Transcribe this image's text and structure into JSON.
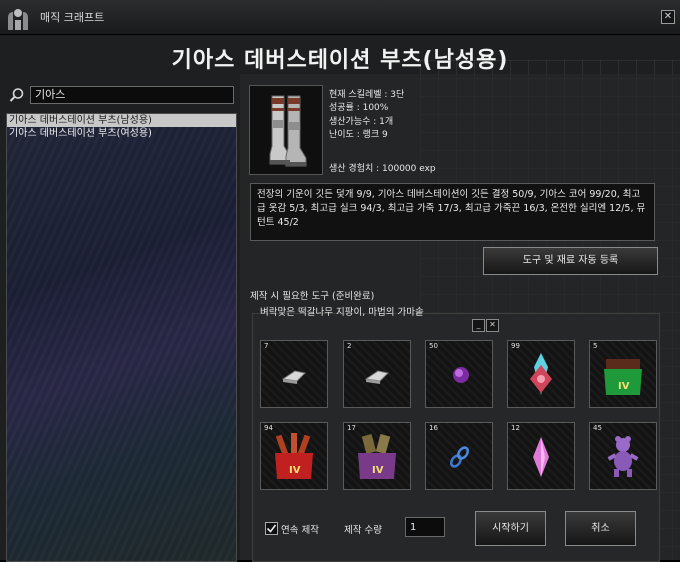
{
  "window": {
    "title": "매직 크래프트",
    "close_glyph": "✕"
  },
  "heading": "기아스 데버스테이션 부츠(남성용)",
  "search": {
    "value": "기아스"
  },
  "recipe_list": [
    {
      "label": "기아스 데버스테이션 부츠(남성용)",
      "selected": true
    },
    {
      "label": "기아스 데버스테이션 부츠(여성용)",
      "selected": false
    }
  ],
  "item_info": {
    "skill_level": "현재 스킬레벨 : 3단",
    "success_rate": "성공률 : 100%",
    "craftable_count": "생산가능수 : 1개",
    "difficulty": "난이도 : 랭크 9",
    "exp": "생산 경험치 : 100000 exp",
    "image_icon": "boots-icon"
  },
  "materials_text": "전장의 기운이 깃든 덫개 9/9, 기아스 데버스테이션이 깃든 결정 50/9, 기아스 코어 99/20, 최고급 옷감 5/3, 최고급 실크 94/3, 최고급 가죽 17/3, 최고급 가죽끈 16/3, 온전한 실리엔 12/5, 뮤턴트 45/2",
  "auto_register_button": "도구 및 재료 자동 등록",
  "tools": {
    "label": "제작 시 필요한 도구 (준비완료)",
    "list": "벼락맞은 떡갈나무 지팡이, 마법의 가마솥"
  },
  "panel_buttons": {
    "minimize": "_",
    "close": "✕"
  },
  "material_slots": [
    {
      "qty": "7",
      "icon": "metal-ingot-icon"
    },
    {
      "qty": "2",
      "icon": "metal-ingot-icon"
    },
    {
      "qty": "50",
      "icon": "purple-gem-icon"
    },
    {
      "qty": "99",
      "icon": "crystal-core-icon"
    },
    {
      "qty": "5",
      "icon": "green-bag-iv-icon"
    },
    {
      "qty": "94",
      "icon": "red-bag-iv-icon"
    },
    {
      "qty": "17",
      "icon": "brown-bag-iv-icon"
    },
    {
      "qty": "16",
      "icon": "chain-link-icon"
    },
    {
      "qty": "12",
      "icon": "pink-crystal-icon"
    },
    {
      "qty": "45",
      "icon": "purple-creature-icon"
    }
  ],
  "footer": {
    "continuous_label": "연속 제작",
    "continuous_checked": true,
    "quantity_label": "제작 수량",
    "quantity_value": "1",
    "start_button": "시작하기",
    "cancel_button": "취소"
  },
  "colors": {
    "selected_row_bg": "#c8c8c8",
    "panel_bg": "#242526"
  }
}
